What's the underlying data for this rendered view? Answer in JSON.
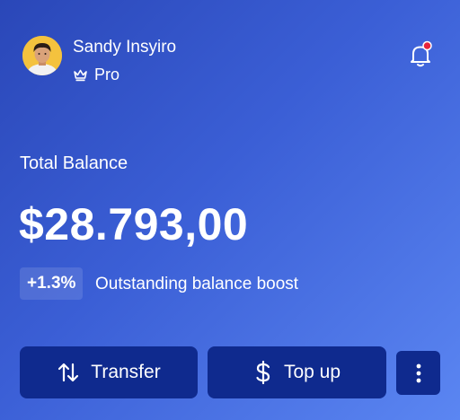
{
  "user": {
    "name": "Sandy Insyiro",
    "plan": "Pro"
  },
  "icons": {
    "avatar": "user-avatar",
    "plan": "crown-icon",
    "notifications": "bell-icon",
    "transfer": "swap-vertical-icon",
    "topup": "dollar-icon",
    "more": "more-vertical-icon"
  },
  "notification": {
    "has_unread": true
  },
  "balance": {
    "label": "Total Balance",
    "amount": "$28.793,00",
    "change": "+1.3%",
    "change_text": "Outstanding balance boost"
  },
  "actions": {
    "transfer_label": "Transfer",
    "topup_label": "Top up"
  },
  "colors": {
    "gradient_start": "#2a47b8",
    "gradient_end": "#5b86f2",
    "button_bg": "#0f2a8e",
    "badge_dot": "#e8243c",
    "avatar_bg": "#f4c23e"
  }
}
